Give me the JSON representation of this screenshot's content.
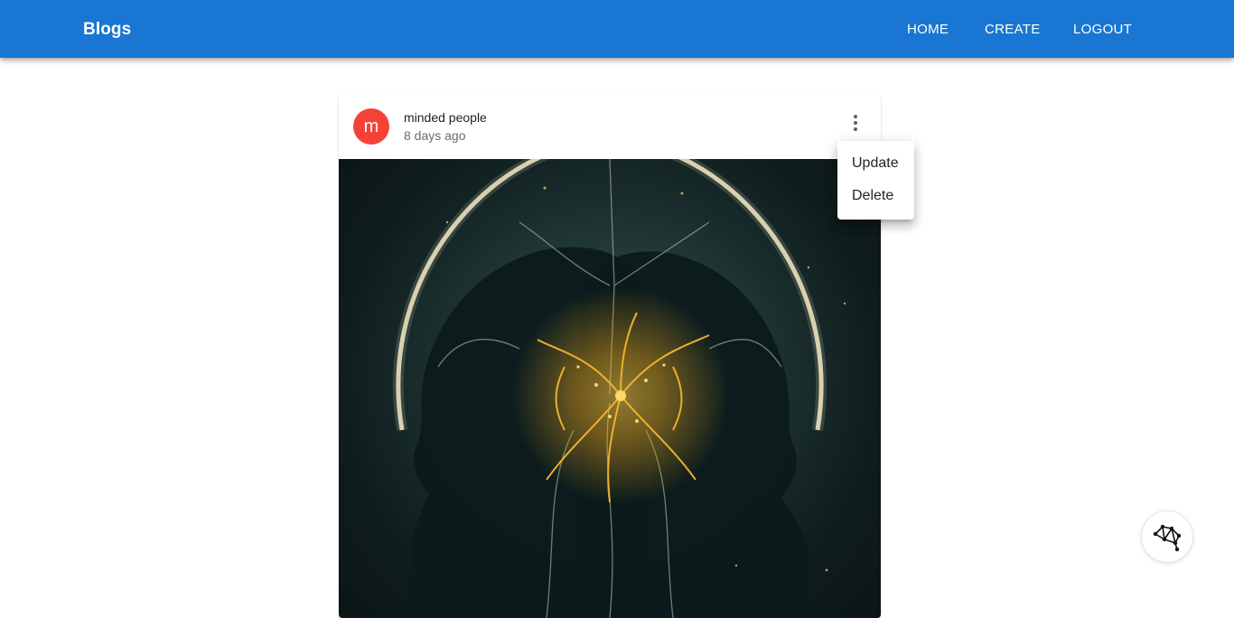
{
  "appbar": {
    "brand": "Blogs",
    "nav": [
      {
        "label": "HOME"
      },
      {
        "label": "CREATE"
      },
      {
        "label": "LOGOUT"
      }
    ],
    "color": "#1976d2"
  },
  "post": {
    "avatar_letter": "m",
    "avatar_color": "#f44336",
    "title": "minded people",
    "subheader": "8 days ago",
    "more_icon": "more-vert-icon",
    "image_alt": "two-heads-neural-network-artwork"
  },
  "menu": {
    "items": [
      {
        "label": "Update"
      },
      {
        "label": "Delete"
      }
    ]
  },
  "fab": {
    "icon": "network-graph-icon"
  }
}
